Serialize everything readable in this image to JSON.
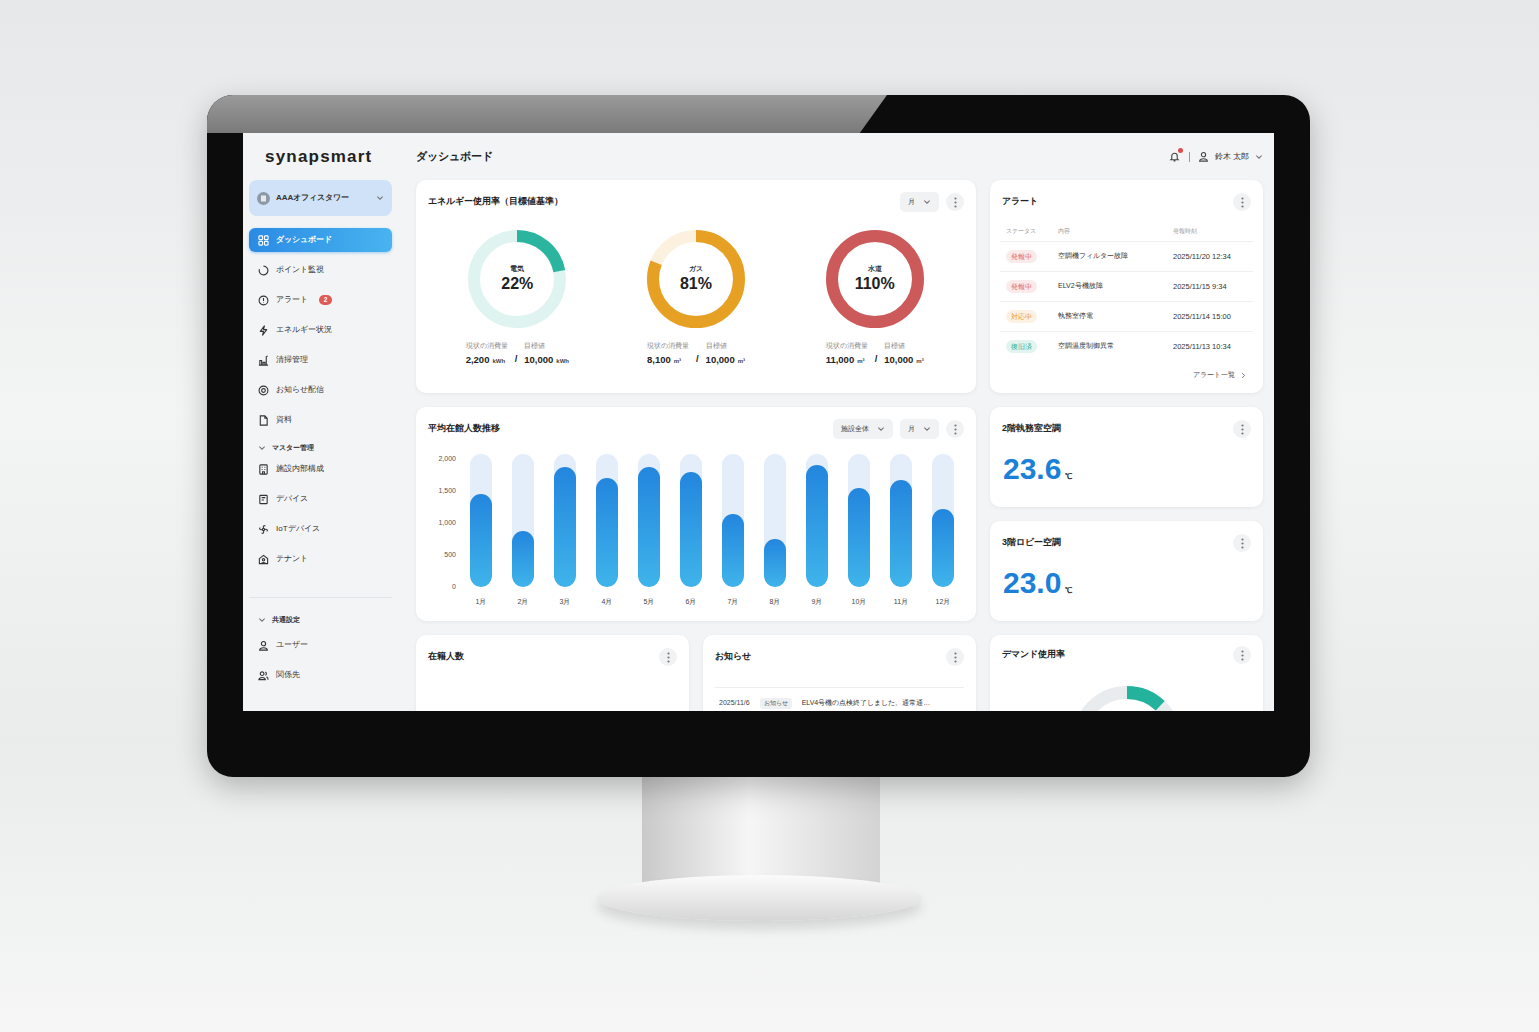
{
  "logo": "synapsmart",
  "header": {
    "title": "ダッシュボード",
    "user": "鈴木 太郎",
    "notification": true
  },
  "sidebar": {
    "facility": "AAAオフィスタワー",
    "items": [
      {
        "label": "ダッシュボード",
        "selected": true
      },
      {
        "label": "ポイント監視",
        "selected": false
      },
      {
        "label": "アラート",
        "selected": false,
        "badge": "2"
      },
      {
        "label": "エネルギー状況",
        "selected": false
      },
      {
        "label": "清掃管理",
        "selected": false
      },
      {
        "label": "お知らせ配信",
        "selected": false
      },
      {
        "label": "資料",
        "selected": false
      }
    ],
    "sections": [
      {
        "title": "マスター管理",
        "expanded": true,
        "items": [
          {
            "label": "施設内部構成",
            "selected": false
          },
          {
            "label": "デバイス",
            "selected": false
          },
          {
            "label": "IoTデバイス",
            "selected": false
          },
          {
            "label": "テナント",
            "selected": false
          }
        ]
      },
      {
        "title": "共通設定",
        "expanded": true,
        "items": [
          {
            "label": "ユーザー",
            "selected": false
          },
          {
            "label": "関係先",
            "selected": false
          }
        ]
      }
    ]
  },
  "energy": {
    "title": "エネルギー使用率（目標値基準）",
    "period": "月",
    "separator": "/",
    "meters": [
      {
        "label": "電気",
        "percent": "22%",
        "level": 0.22,
        "color": "#2bb59f",
        "current_label": "現状の消費量",
        "target_label": "目標値",
        "current": "2,200",
        "target": "10,000",
        "unit": "kWh"
      },
      {
        "label": "ガス",
        "percent": "81%",
        "level": 0.81,
        "color": "#e6a024",
        "current_label": "現状の消費量",
        "target_label": "目標値",
        "current": "8,100",
        "target": "10,000",
        "unit": "m³"
      },
      {
        "label": "水道",
        "percent": "110%",
        "level": 1,
        "color": "#cc5a5a",
        "current_label": "現状の消費量",
        "target_label": "目標値",
        "current": "11,000",
        "target": "10,000",
        "unit": "m³"
      }
    ]
  },
  "alerts": {
    "title": "アラート",
    "columns": [
      "ステータス",
      "内容",
      "発報時刻"
    ],
    "rows": [
      {
        "status": "発報中",
        "color": "#e06464",
        "content": "空調機フィルター故障",
        "time": "2025/11/20 12:34"
      },
      {
        "status": "発報中",
        "color": "#e06464",
        "content": "ELV2号機故障",
        "time": "2025/11/15 9:34"
      },
      {
        "status": "対応中",
        "color": "#e8952a",
        "content": "執務室停電",
        "time": "2025/11/14 15:00"
      },
      {
        "status": "復旧済",
        "color": "#2fae8f",
        "content": "空調温度制御異常",
        "time": "2025/11/13 10:34"
      }
    ],
    "link": "アラート一覧"
  },
  "occupancy_chart": {
    "title": "平均在館人数推移",
    "filters": [
      "施設全体",
      "月"
    ],
    "y_ticks": [
      "2,000",
      "1,500",
      "1,000",
      "500",
      "0"
    ],
    "x_labels": [
      "1月",
      "2月",
      "3月",
      "4月",
      "5月",
      "6月",
      "7月",
      "8月",
      "9月",
      "10月",
      "11月",
      "12月"
    ],
    "values": [
      1450,
      880,
      1880,
      1700,
      1870,
      1790,
      1140,
      750,
      1900,
      1540,
      1670,
      1220
    ]
  },
  "temperatures": [
    {
      "title": "2階執務室空調",
      "value": "23.6",
      "unit": "℃"
    },
    {
      "title": "3階ロビー空調",
      "value": "23.0",
      "unit": "℃"
    }
  ],
  "headcount": {
    "title": "在籍人数"
  },
  "news": {
    "title": "お知らせ",
    "rows": [
      {
        "date": "2025/11/6",
        "tag": "お知らせ",
        "text": "ELV4号機の点検終了しました。通常通…"
      }
    ]
  },
  "demand": {
    "title": "デマンド使用率",
    "level": 0.12
  }
}
